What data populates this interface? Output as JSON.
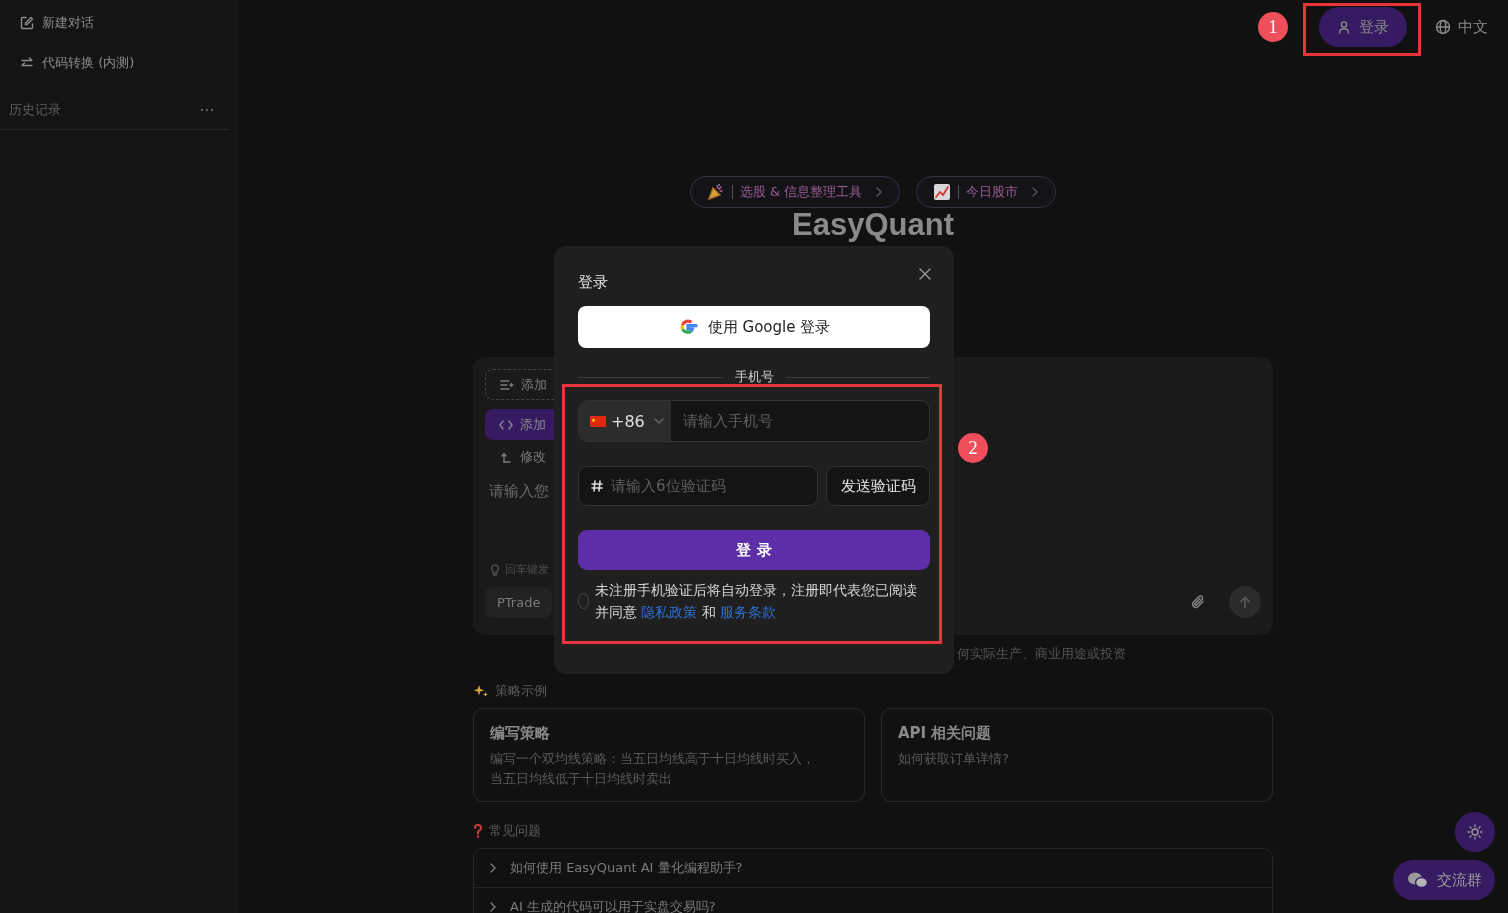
{
  "sidebar": {
    "items": [
      {
        "label": "新建对话",
        "kind": "new"
      },
      {
        "label": "代码转换 (内测)",
        "kind": "convert"
      }
    ],
    "history_title": "历史记录"
  },
  "topbar": {
    "marker": "1",
    "login": "登录",
    "language": "中文"
  },
  "banners": [
    {
      "text": "选股 & 信息整理工具",
      "kind": "party"
    },
    {
      "text": "今日股市",
      "kind": "chart"
    }
  ],
  "title": "EasyQuant",
  "composer": {
    "chips": [
      {
        "label": "添加",
        "kind": "dashed"
      },
      {
        "label": "添加",
        "kind": "active"
      },
      {
        "label": "修改",
        "kind": "plain"
      }
    ],
    "placeholder": "请输入您",
    "hint": "回车键发",
    "platform": "PTrade"
  },
  "disclaimer": "何实际生产、商业用途或投资",
  "examples": {
    "title": "策略示例",
    "cards": [
      {
        "title": "编写策略",
        "text": "编写一个双均线策略：当五日均线高于十日均线时买入，当五日均线低于十日均线时卖出"
      },
      {
        "title": "API 相关问题",
        "text": "如何获取订单详情?"
      }
    ]
  },
  "faq": {
    "title": "常见问题",
    "items": [
      {
        "question": "如何使用 EasyQuant AI 量化编程助手?",
        "expanded": false
      },
      {
        "question": "AI 生成的代码可以用于实盘交易吗?",
        "expanded": false
      }
    ]
  },
  "modal": {
    "title": "登录",
    "google_button": "使用 Google 登录",
    "divider": "手机号",
    "country_code": "+86",
    "phone_placeholder": "请输入手机号",
    "code_placeholder": "请输入6位验证码",
    "send_button": "发送验证码",
    "submit": "登 录",
    "agreed": false,
    "agreement": "未注册手机验证后将自动登录，注册即代表您已阅读并同意",
    "link_privacy": "隐私政策",
    "joiner": "和",
    "link_terms": "服务条款",
    "marker": "2"
  },
  "floating": {
    "group_button": "交流群"
  }
}
